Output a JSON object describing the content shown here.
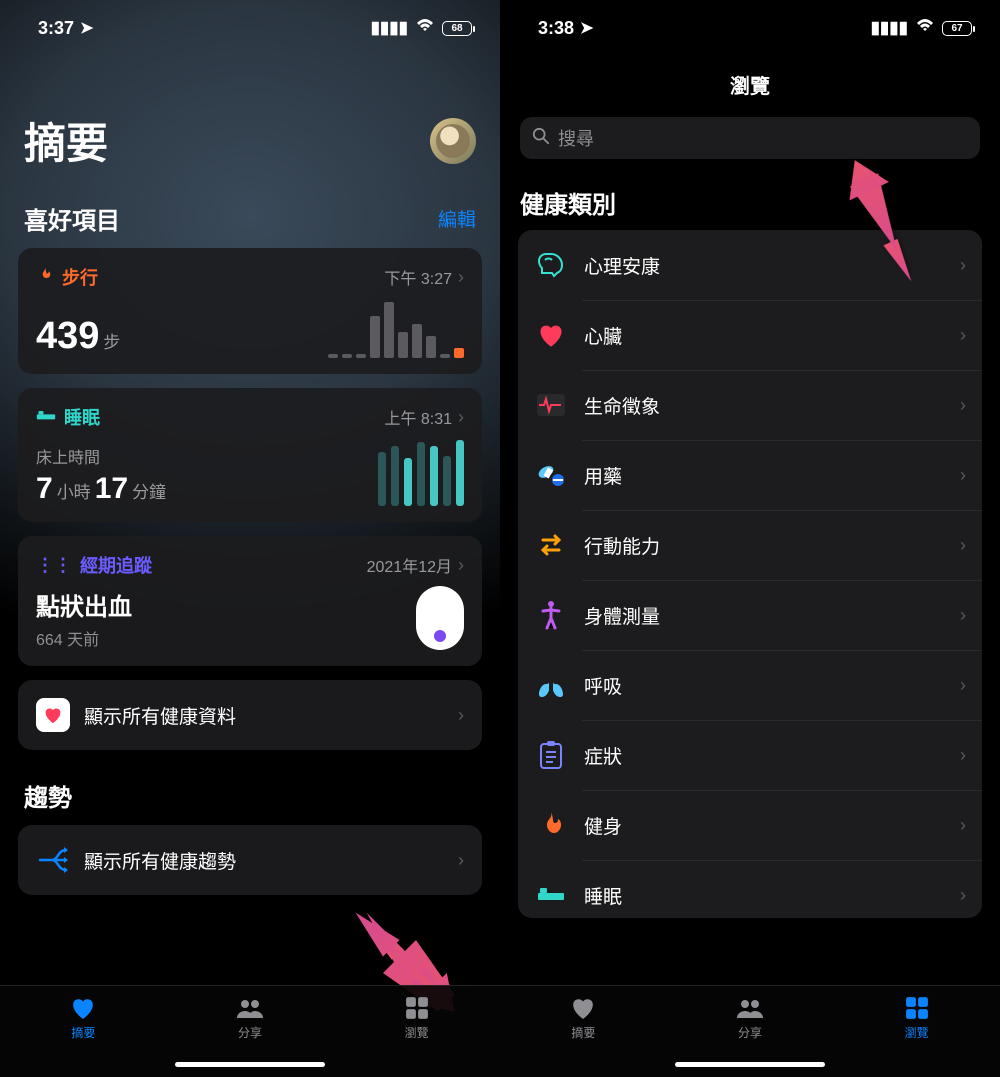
{
  "left": {
    "status": {
      "time": "3:37",
      "battery": "68"
    },
    "page_title": "摘要",
    "favorites": {
      "header": "喜好項目",
      "edit": "編輯",
      "steps": {
        "title": "步行",
        "time": "下午 3:27",
        "value": "439",
        "unit": "步"
      },
      "sleep": {
        "title": "睡眠",
        "time": "上午 8:31",
        "label": "床上時間",
        "h": "7",
        "h_unit": "小時",
        "m": "17",
        "m_unit": "分鐘"
      },
      "cycle": {
        "title": "經期追蹤",
        "time": "2021年12月",
        "status": "點狀出血",
        "days": "664 天前"
      },
      "all_data": "顯示所有健康資料"
    },
    "trends": {
      "header": "趨勢",
      "all": "顯示所有健康趨勢"
    },
    "tabs": {
      "summary": "摘要",
      "share": "分享",
      "browse": "瀏覽"
    }
  },
  "right": {
    "status": {
      "time": "3:38",
      "battery": "67"
    },
    "nav_title": "瀏覽",
    "search_placeholder": "搜尋",
    "section_title": "健康類別",
    "categories": [
      {
        "label": "心理安康"
      },
      {
        "label": "心臟"
      },
      {
        "label": "生命徵象"
      },
      {
        "label": "用藥"
      },
      {
        "label": "行動能力"
      },
      {
        "label": "身體測量"
      },
      {
        "label": "呼吸"
      },
      {
        "label": "症狀"
      },
      {
        "label": "健身"
      },
      {
        "label": "睡眠"
      }
    ],
    "tabs": {
      "summary": "摘要",
      "share": "分享",
      "browse": "瀏覽"
    }
  }
}
